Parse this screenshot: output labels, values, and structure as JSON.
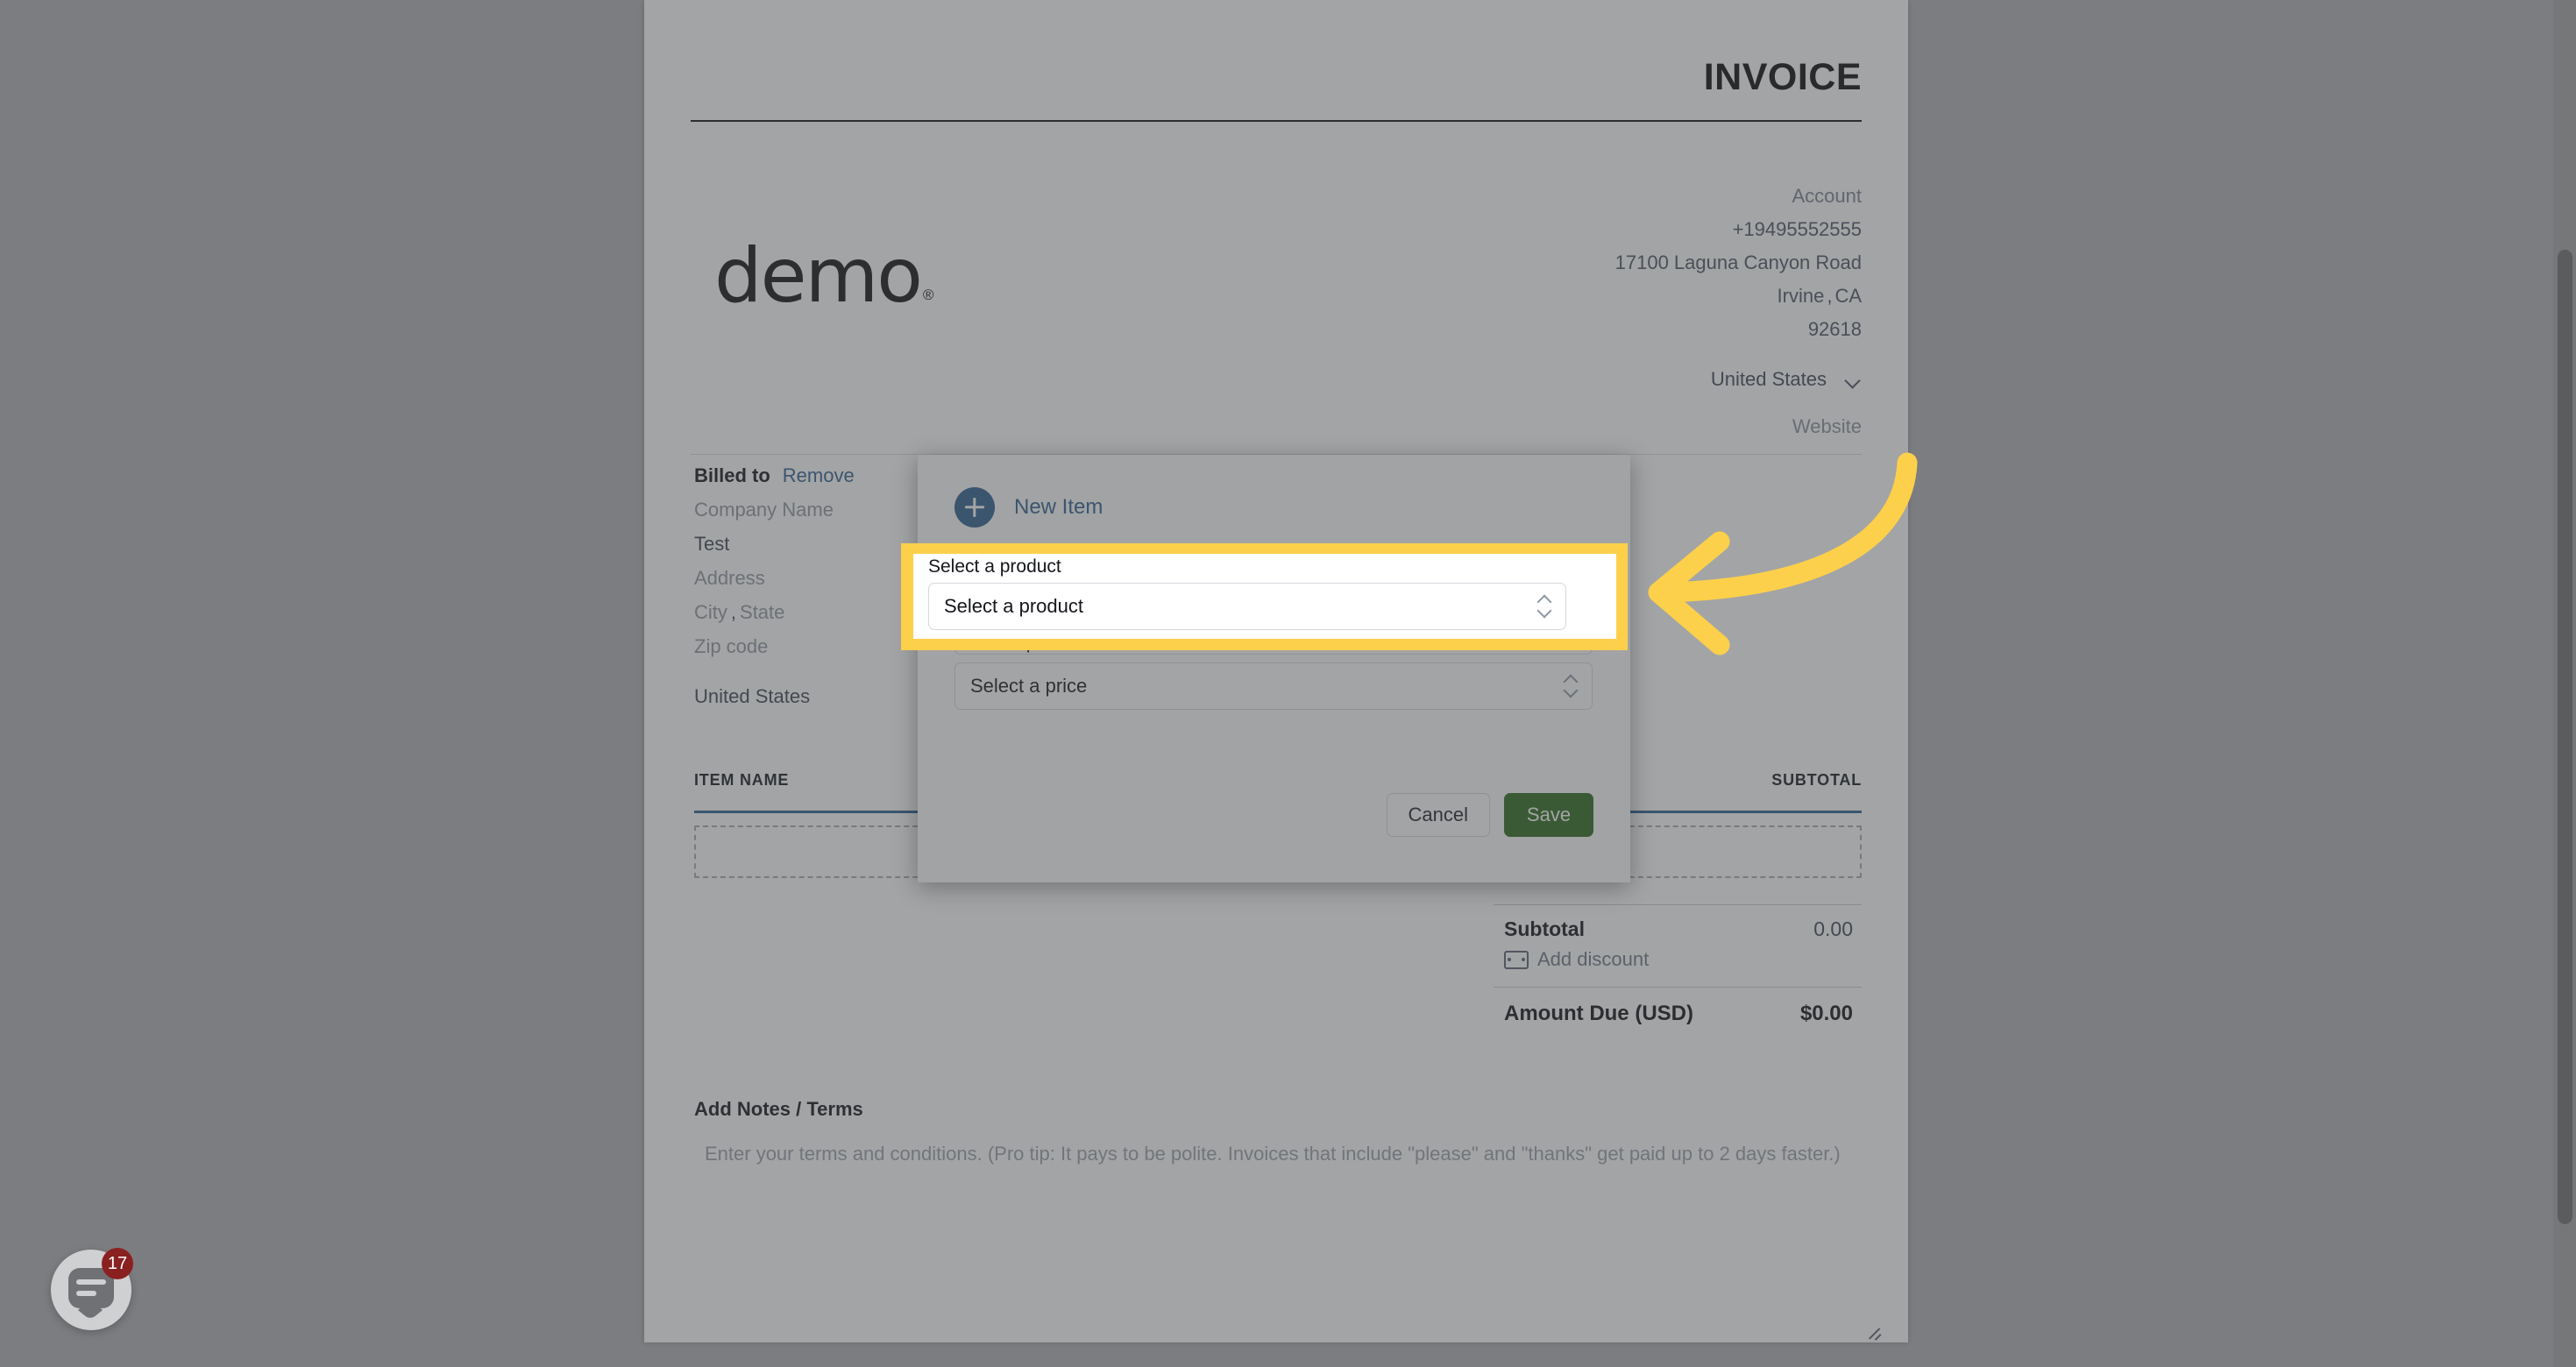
{
  "colors": {
    "page_backdrop": "#7c7d80",
    "accent_blue": "#2f6093",
    "save_green": "#2c6b1f",
    "highlight_yellow": "#fdd04b",
    "badge_red": "#8a2020",
    "table_rule_blue": "#2f6296"
  },
  "invoice": {
    "title": "INVOICE",
    "logo_text": "demo",
    "logo_mark": "®",
    "account": {
      "label": "Account",
      "phone": "+19495552555",
      "street": "17100 Laguna Canyon Road",
      "city": "Irvine",
      "city_state_sep": ",",
      "state": "CA",
      "zip": "92618",
      "country": "United States",
      "website_placeholder": "Website"
    },
    "billed_to": {
      "title": "Billed to",
      "remove_label": "Remove",
      "company_placeholder": "Company Name",
      "name": "Test",
      "address_placeholder": "Address",
      "city_placeholder": "City",
      "city_state_sep": ",",
      "state_placeholder": "State",
      "zip_placeholder": "Zip code",
      "country": "United States"
    },
    "table": {
      "col_item_name": "ITEM NAME",
      "col_subtotal": "SUBTOTAL"
    },
    "totals": {
      "subtotal_label": "Subtotal",
      "subtotal_value": "0.00",
      "add_discount_label": "Add discount",
      "amount_due_label": "Amount Due (USD)",
      "amount_due_value": "$0.00"
    },
    "notes": {
      "title": "Add Notes / Terms",
      "placeholder": "Enter your terms and conditions. (Pro tip: It pays to be polite. Invoices that include \"please\" and \"thanks\" get paid up to 2 days faster.)"
    }
  },
  "modal": {
    "header_label": "New Item",
    "product": {
      "label": "Select a product",
      "value": "Select a product"
    },
    "price": {
      "label": "Select a price",
      "value": "Select a price"
    },
    "cancel_label": "Cancel",
    "save_label": "Save"
  },
  "highlight": {
    "label": "Select a product",
    "value": "Select a product"
  },
  "chat": {
    "unread_count": "17"
  }
}
